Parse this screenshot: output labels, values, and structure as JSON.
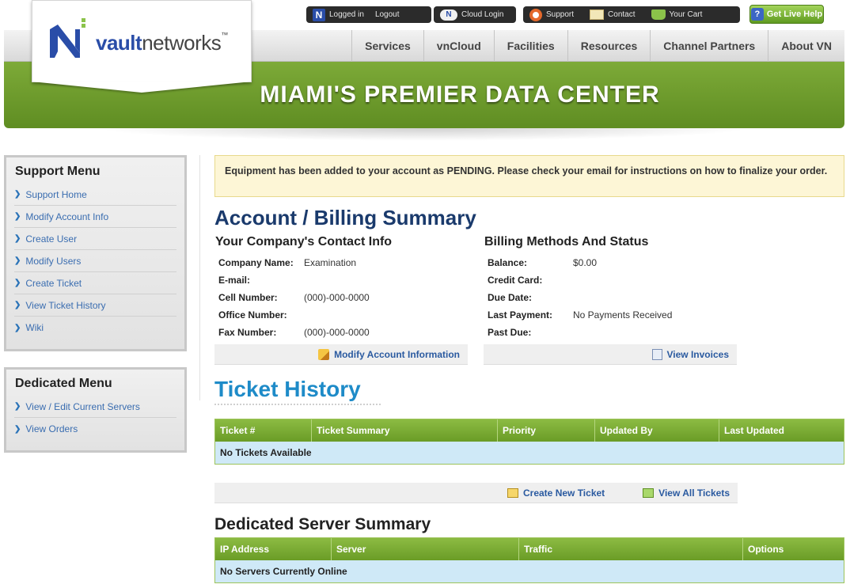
{
  "utility": {
    "logged_in": "Logged in",
    "logout": "Logout",
    "cloud_login": "Cloud Login",
    "support": "Support",
    "contact": "Contact",
    "cart": "Your Cart",
    "live_help": "Get Live Help"
  },
  "logo": {
    "prefix": "vault",
    "suffix": "networks",
    "tm": "™"
  },
  "nav": [
    "Services",
    "vnCloud",
    "Facilities",
    "Resources",
    "Channel Partners",
    "About VN"
  ],
  "banner": {
    "title": "MIAMI'S PREMIER DATA CENTER"
  },
  "support_menu": {
    "title": "Support Menu",
    "items": [
      "Support Home",
      "Modify Account Info",
      "Create User",
      "Modify Users",
      "Create Ticket",
      "View Ticket History",
      "Wiki"
    ]
  },
  "dedicated_menu": {
    "title": "Dedicated Menu",
    "items": [
      "View / Edit Current Servers",
      "View Orders"
    ]
  },
  "alert": "Equipment has been added to your account as PENDING. Please check your email for instructions on how to finalize your order.",
  "account": {
    "heading": "Account / Billing Summary",
    "contact_heading": "Your Company's Contact Info",
    "contact": [
      {
        "key": "Company Name:",
        "value": "Examination"
      },
      {
        "key": "E-mail:",
        "value": ""
      },
      {
        "key": "Cell Number:",
        "value": "(000)-000-0000"
      },
      {
        "key": "Office Number:",
        "value": ""
      },
      {
        "key": "Fax Number:",
        "value": "(000)-000-0000"
      }
    ],
    "modify_link": "Modify Account Information",
    "billing_heading": "Billing Methods And Status",
    "billing": [
      {
        "key": "Balance:",
        "value": "$0.00"
      },
      {
        "key": "Credit Card:",
        "value": ""
      },
      {
        "key": "Due Date:",
        "value": ""
      },
      {
        "key": "Last Payment:",
        "value": "No Payments Received"
      },
      {
        "key": "Past Due:",
        "value": ""
      }
    ],
    "invoices_link": "View Invoices"
  },
  "tickets": {
    "heading": "Ticket History",
    "columns": [
      "Ticket #",
      "Ticket Summary",
      "Priority",
      "Updated By",
      "Last Updated"
    ],
    "empty": "No Tickets Available",
    "create_link": "Create New Ticket",
    "view_all_link": "View All Tickets"
  },
  "dedicated": {
    "heading": "Dedicated Server Summary",
    "columns": [
      "IP Address",
      "Server",
      "Traffic",
      "Options"
    ],
    "empty": "No Servers Currently Online"
  },
  "colors": {
    "brand_green": "#6a9c26",
    "brand_blue": "#2a4da8",
    "link": "#2a5aa0",
    "heading_blue": "#1e8bc8"
  }
}
